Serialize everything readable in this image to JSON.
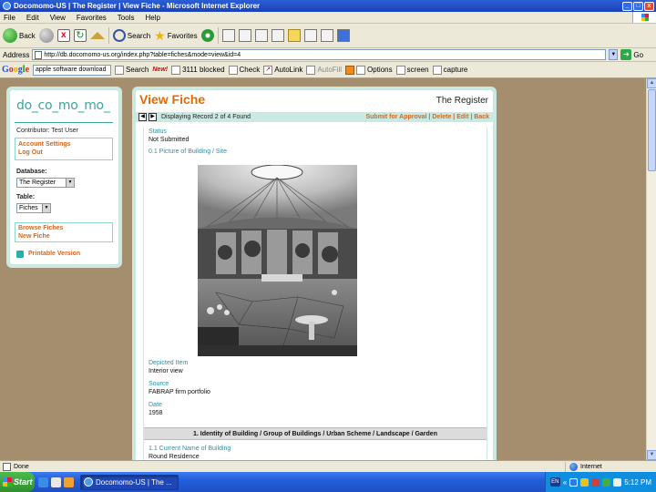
{
  "window": {
    "title": "Docomomo-US | The Register | View Fiche - Microsoft Internet Explorer"
  },
  "menu": [
    "File",
    "Edit",
    "View",
    "Favorites",
    "Tools",
    "Help"
  ],
  "toolbar": {
    "back": "Back",
    "search": "Search",
    "favorites": "Favorites"
  },
  "address": {
    "label": "Address",
    "url": "http://db.docomomo-us.org/index.php?table=fiches&mode=view&id=4",
    "go": "Go"
  },
  "googlebar": {
    "query": "apple software download",
    "search": "Search",
    "new_badge": "New!",
    "blocked": "3111 blocked",
    "check": "Check",
    "autolink": "AutoLink",
    "autofill": "AutoFill",
    "options": "Options",
    "screen": "screen",
    "capture": "capture"
  },
  "sidebar": {
    "logo": "do_co_mo_mo_",
    "contributor": "Contributor: Test User",
    "account_settings": "Account Settings",
    "log_out": "Log Out",
    "database_label": "Database:",
    "database_value": "The Register",
    "table_label": "Table:",
    "table_value": "Fiches",
    "browse_fiches": "Browse Fiches",
    "new_fiche": "New Fiche",
    "printable": "Printable Version"
  },
  "main": {
    "title": "View Fiche",
    "register": "The Register",
    "record_info": "Displaying Record 2 of 4 Found",
    "actions": "Submit for Approval | Delete | Edit | Back",
    "status_label": "Status",
    "status_value": "Not Submitted",
    "picture_label": "0.1 Picture of Building / Site",
    "depicted_label": "Depicted Item",
    "depicted_value": "Interior view",
    "source_label": "Source",
    "source_value": "FABRAP firm portfolio",
    "date_label": "Date",
    "date_value": "1958",
    "section_heading": "1. Identity of Building / Group of Buildings / Urban Scheme / Landscape / Garden",
    "current_name_label": "1.1 Current Name of Building",
    "current_name_value": "Round Residence"
  },
  "statusbar": {
    "status": "Done",
    "zone": "Internet"
  },
  "taskbar": {
    "start": "Start",
    "task": "Docomomo-US | The ...",
    "lang": "EN",
    "clock": "5:12 PM"
  }
}
